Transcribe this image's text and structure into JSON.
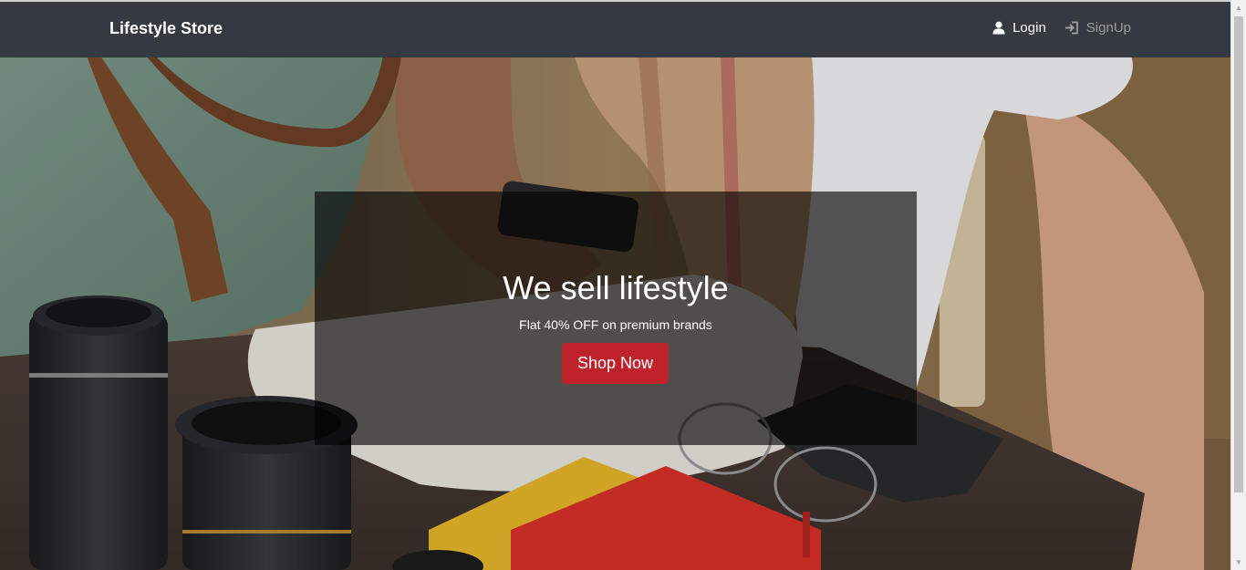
{
  "navbar": {
    "brand": "Lifestyle Store",
    "links": {
      "login": {
        "label": "Login",
        "icon": "user-icon"
      },
      "signup": {
        "label": "SignUp",
        "icon": "sign-in-icon"
      }
    }
  },
  "hero": {
    "title": "We sell lifestyle",
    "subtitle": "Flat 40% OFF on premium brands",
    "cta_label": "Shop Now"
  },
  "colors": {
    "navbar_bg": "#343a40",
    "cta_bg": "#c0222b",
    "link_active": "#ffffff",
    "link_muted": "#9a9da0"
  }
}
